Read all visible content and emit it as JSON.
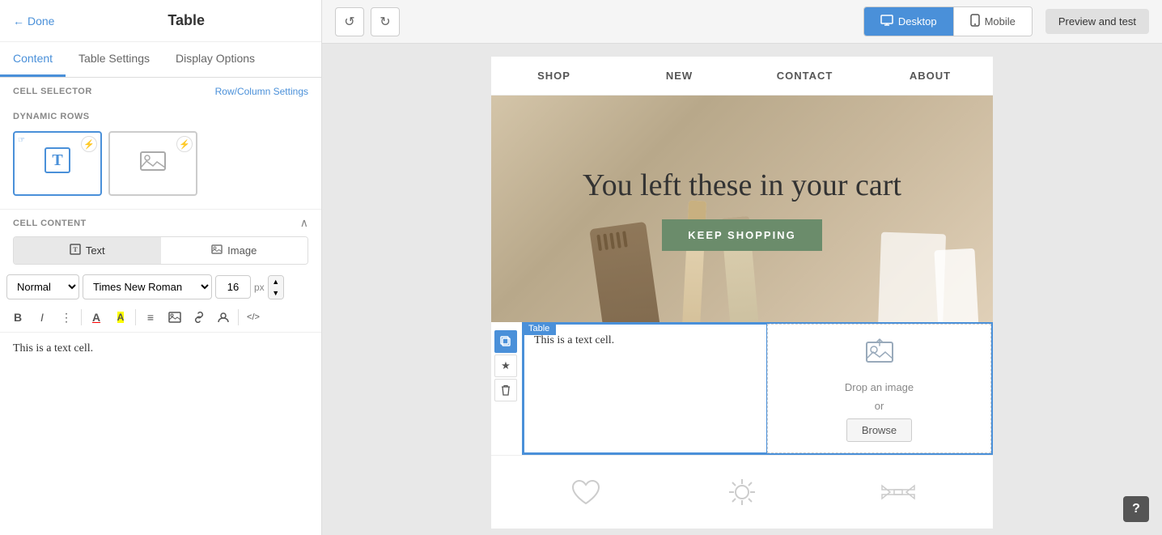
{
  "header": {
    "done_label": "Done",
    "title": "Table",
    "tabs": [
      {
        "label": "Content",
        "active": true
      },
      {
        "label": "Table Settings",
        "active": false
      },
      {
        "label": "Display Options",
        "active": false
      }
    ]
  },
  "left_panel": {
    "cell_selector_label": "CELL SELECTOR",
    "row_col_settings_link": "Row/Column Settings",
    "dynamic_rows_label": "DYNAMIC ROWS",
    "cell_content_label": "CELL CONTENT",
    "toggle_text": "Text",
    "toggle_image": "Image",
    "font_style": "Normal",
    "font_family": "Times New Roman",
    "font_size": "16",
    "font_size_unit": "px",
    "text_content": "This is a text cell."
  },
  "toolbar": {
    "undo_label": "↺",
    "redo_label": "↻",
    "desktop_label": "Desktop",
    "mobile_label": "Mobile",
    "preview_test_label": "Preview and test"
  },
  "email": {
    "nav_items": [
      {
        "label": "SHOP"
      },
      {
        "label": "NEW"
      },
      {
        "label": "CONTACT"
      },
      {
        "label": "ABOUT"
      }
    ],
    "hero_title": "You left these in your cart",
    "keep_shopping_label": "KEEP SHOPPING",
    "table_label": "Table",
    "text_cell_content": "This is a text cell.",
    "image_cell_drop_label": "Drop an image",
    "image_cell_or_label": "or",
    "browse_label": "Browse"
  },
  "icons": {
    "bold": "B",
    "italic": "I",
    "more": "⋮",
    "text_color": "A",
    "highlight": "A",
    "align": "≡",
    "image": "🖼",
    "link": "🔗",
    "person": "👤",
    "code": "</>",
    "copy": "⧉",
    "star": "★",
    "trash": "🗑",
    "chevron_up": "∧",
    "question": "?"
  }
}
